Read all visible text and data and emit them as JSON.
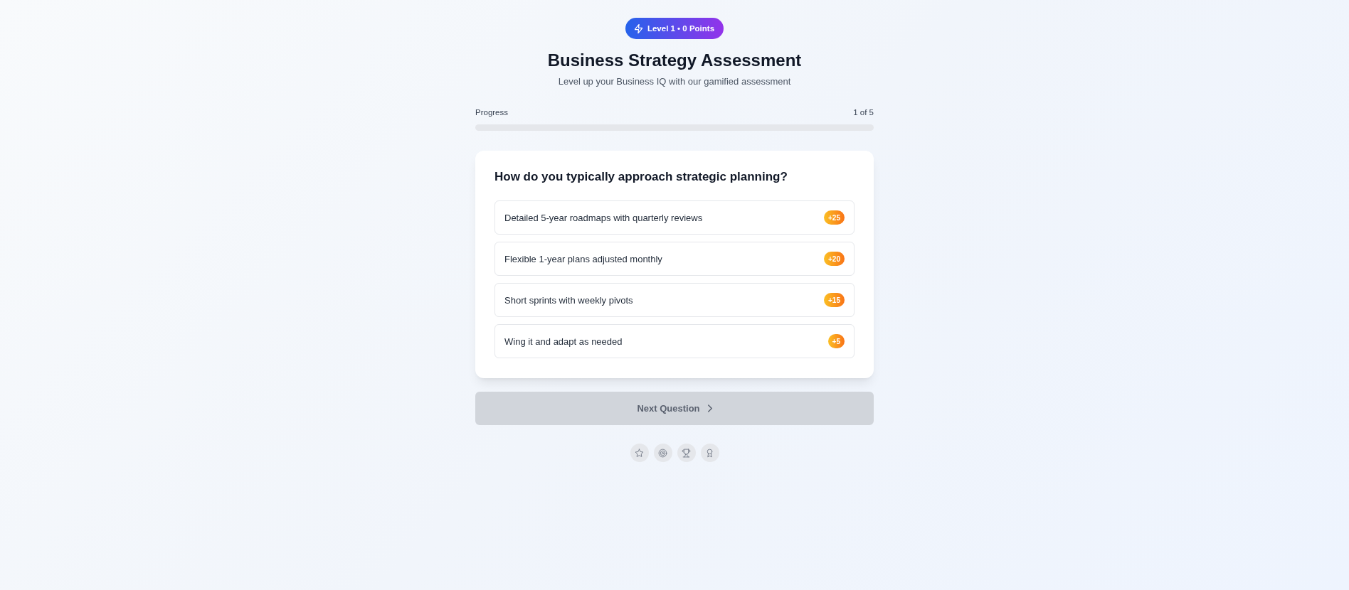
{
  "badge": {
    "label": "Level 1 • 0 Points"
  },
  "title": "Business Strategy Assessment",
  "subtitle": "Level up your Business IQ with our gamified assessment",
  "progress": {
    "label": "Progress",
    "count": "1 of 5",
    "level": 0
  },
  "question": {
    "text": "How do you typically approach strategic planning?",
    "options": [
      {
        "label": "Detailed 5-year roadmaps with quarterly reviews",
        "points": "+25",
        "selected": false
      },
      {
        "label": "Flexible 1-year plans adjusted monthly",
        "points": "+20",
        "selected": false
      },
      {
        "label": "Short sprints with weekly pivots",
        "points": "+15",
        "selected": false
      },
      {
        "label": "Wing it and adapt as needed",
        "points": "+5",
        "selected": false
      }
    ]
  },
  "next_button": {
    "label": "Next Question",
    "disabled": true
  },
  "achievements": [
    {
      "kind": "star",
      "unlocked": false
    },
    {
      "kind": "target",
      "unlocked": false
    },
    {
      "kind": "trophy",
      "unlocked": false
    },
    {
      "kind": "award",
      "unlocked": false
    }
  ]
}
